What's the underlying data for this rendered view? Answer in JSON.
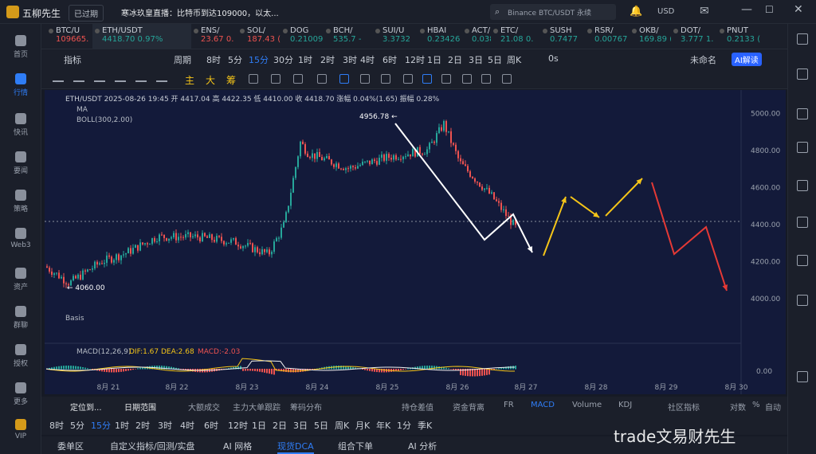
{
  "app": {
    "title": "五柳先生",
    "expired": "已过期",
    "news": "寒冰玖皇直播：比特币到达109000，以太...",
    "search_placeholder": "Binance BTC/USDT 永续",
    "currency": "USD"
  },
  "leftnav": {
    "items": [
      {
        "label": "首页",
        "icon": "home-icon"
      },
      {
        "label": "行情",
        "icon": "market-icon"
      },
      {
        "label": "快讯",
        "icon": "news-icon"
      },
      {
        "label": "要闻",
        "icon": "headline-icon"
      },
      {
        "label": "策略",
        "icon": "strategy-icon"
      },
      {
        "label": "Web3",
        "icon": "web3-icon"
      },
      {
        "label": "资产",
        "icon": "wallet-icon"
      },
      {
        "label": "群聊",
        "icon": "chat-icon"
      },
      {
        "label": "授权",
        "icon": "key-icon"
      },
      {
        "label": "更多",
        "icon": "more-icon"
      },
      {
        "label": "VIP",
        "icon": "vip-icon"
      }
    ]
  },
  "tickers": [
    {
      "name": "BTC/U",
      "price": "109665.",
      "up": false
    },
    {
      "name": "ETH/USDT",
      "price": "4418.70",
      "chg": "0.97%",
      "up": true
    },
    {
      "name": "ENS/",
      "price": "23.67",
      "chg": "0.",
      "up": false
    },
    {
      "name": "SOL/",
      "price": "187.43",
      "chg": "(",
      "up": false
    },
    {
      "name": "DOG",
      "price": "0.21009",
      "up": true
    },
    {
      "name": "BCH/",
      "price": "535.7",
      "chg": "-",
      "up": true
    },
    {
      "name": "SUI/U",
      "price": "3.3732",
      "up": true
    },
    {
      "name": "HBAI",
      "price": "0.23426",
      "up": true
    },
    {
      "name": "ACT/",
      "price": "0.0386",
      "chg": "-",
      "up": true
    },
    {
      "name": "ETC/",
      "price": "21.08",
      "chg": "0.",
      "up": true
    },
    {
      "name": "SUSH",
      "price": "0.7477",
      "up": true
    },
    {
      "name": "RSR/",
      "price": "0.00767",
      "up": true
    },
    {
      "name": "OKB/",
      "price": "169.89",
      "chg": "(",
      "up": true
    },
    {
      "name": "DOT/",
      "price": "3.777",
      "chg": "1.",
      "up": true
    },
    {
      "name": "PNUT",
      "price": "0.2133",
      "chg": "(",
      "up": true
    }
  ],
  "toolbar": {
    "indicator": "指标",
    "period": "周期",
    "intervals": [
      "8时",
      "5分",
      "15分",
      "30分",
      "1时",
      "2时",
      "3时",
      "4时",
      "6时",
      "12时",
      "1日",
      "2日",
      "3日",
      "5日",
      "周K"
    ],
    "active": "15分",
    "zero_s": "0s",
    "unnamed": "未命名",
    "ai": "AI解读"
  },
  "drawbar": {
    "labels": [
      "主",
      "大",
      "筹"
    ]
  },
  "chart": {
    "legend": "ETH/USDT  2025-08-26 19:45  开 4417.04  高 4422.35  低 4410.00  收 4418.70  涨幅 0.04%(1.65)  振幅 0.28%",
    "ma": "MA",
    "boll": "BOLL(300,2.00)",
    "basis": "Basis",
    "macd_label": "MACD(12,26,9)",
    "dif": "DIF:1.67",
    "dea": "DEA:2.68",
    "macd": "MACD:-2.03",
    "high_label": "4956.78",
    "low_label": "4060.00",
    "y_ticks": [
      "5000.00",
      "4800.00",
      "4600.00",
      "4400.00",
      "4200.00",
      "4000.00"
    ],
    "macd_tick": "0.00",
    "x_ticks": [
      "8月 21",
      "8月 22",
      "8月 23",
      "8月 24",
      "8月 25",
      "8月 26",
      "8月 27",
      "8月 28",
      "8月 29",
      "8月 30"
    ],
    "colors": {
      "up": "#26a69a",
      "down": "#ef5350",
      "bg": "#131a3a",
      "white": "#ffffff",
      "yellow": "#f5c518",
      "red": "#e53935"
    }
  },
  "chart_data": {
    "type": "line",
    "title": "ETH/USDT",
    "x": [
      "8月21",
      "8月22",
      "8月23",
      "8月24",
      "8月25",
      "8月26"
    ],
    "series": [
      {
        "name": "ETH/USDT",
        "values": [
          4240,
          4330,
          4780,
          4720,
          4956.78,
          4418.7
        ]
      }
    ],
    "ylim": [
      3950,
      5050
    ]
  },
  "bot1": {
    "locate": "定位到...",
    "range": "日期范围",
    "items": [
      "大额成交",
      "主力大单跟踪",
      "筹码分布",
      "持仓差值",
      "资金背离",
      "FR",
      "MACD",
      "Volume",
      "KDJ",
      "社区指标",
      "对数",
      "%",
      "自动"
    ]
  },
  "bot2": {
    "items": [
      "8时",
      "5分",
      "15分",
      "1时",
      "2时",
      "3时",
      "4时",
      "6时",
      "12时",
      "1日",
      "2日",
      "3日",
      "5日",
      "周K",
      "月K",
      "年K",
      "1分",
      "季K"
    ],
    "active": "15分"
  },
  "bot3": {
    "tabs": [
      "委单区",
      "自定义指标/回测/实盘",
      "AI 网格",
      "现货DCA",
      "组合下单",
      "AI 分析"
    ],
    "active": "现货DCA"
  },
  "watermark": "trade文易财先生"
}
